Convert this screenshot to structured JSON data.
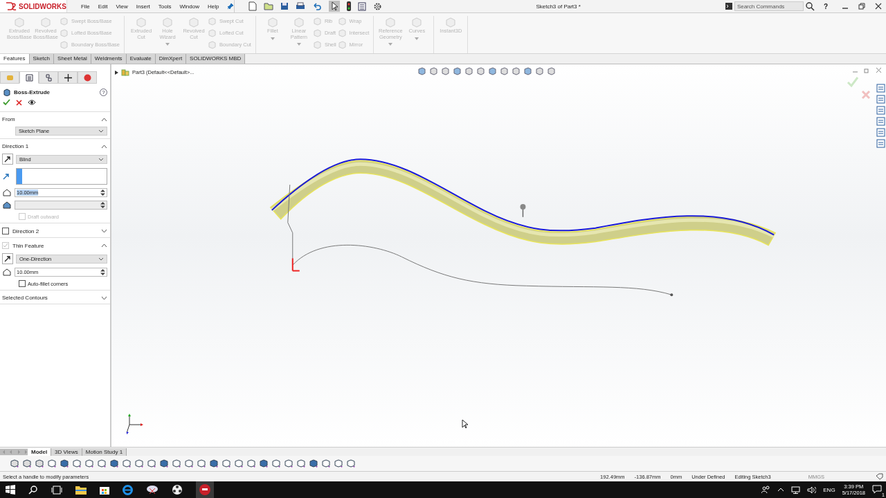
{
  "titlebar": {
    "logo": "SOLIDWORKS",
    "menu": [
      "File",
      "Edit",
      "View",
      "Insert",
      "Tools",
      "Window",
      "Help"
    ],
    "document_title": "Sketch3 of Part3 *",
    "search": {
      "placeholder": "Search Commands"
    },
    "help": "?"
  },
  "ribbon": {
    "groups": [
      {
        "columns": [
          {
            "kind": "large",
            "items": [
              {
                "label": "Extruded\nBoss/Base",
                "disabled": true,
                "dropdown": false
              }
            ]
          },
          {
            "kind": "large",
            "items": [
              {
                "label": "Revolved\nBoss/Base",
                "disabled": true,
                "dropdown": false
              }
            ]
          },
          {
            "kind": "stack",
            "items": [
              {
                "label": "Swept Boss/Base",
                "disabled": true
              },
              {
                "label": "Lofted Boss/Base",
                "disabled": true
              },
              {
                "label": "Boundary Boss/Base",
                "disabled": true
              }
            ]
          }
        ]
      },
      {
        "columns": [
          {
            "kind": "large",
            "items": [
              {
                "label": "Extruded\nCut",
                "disabled": true,
                "dropdown": false
              }
            ]
          },
          {
            "kind": "large",
            "items": [
              {
                "label": "Hole\nWizard",
                "disabled": true,
                "dropdown": true
              }
            ]
          },
          {
            "kind": "large",
            "items": [
              {
                "label": "Revolved\nCut",
                "disabled": true,
                "dropdown": false
              }
            ]
          },
          {
            "kind": "stack",
            "items": [
              {
                "label": "Swept Cut",
                "disabled": true
              },
              {
                "label": "Lofted Cut",
                "disabled": true
              },
              {
                "label": "Boundary Cut",
                "disabled": true
              }
            ]
          }
        ]
      },
      {
        "columns": [
          {
            "kind": "large",
            "items": [
              {
                "label": "Fillet",
                "disabled": true,
                "dropdown": true
              }
            ]
          },
          {
            "kind": "large",
            "items": [
              {
                "label": "Linear\nPattern",
                "disabled": true,
                "dropdown": true
              }
            ]
          },
          {
            "kind": "stack",
            "items": [
              {
                "label": "Rib",
                "disabled": true
              },
              {
                "label": "Draft",
                "disabled": true
              },
              {
                "label": "Shell",
                "disabled": true
              }
            ]
          },
          {
            "kind": "stack",
            "items": [
              {
                "label": "Wrap",
                "disabled": true
              },
              {
                "label": "Intersect",
                "disabled": true
              },
              {
                "label": "Mirror",
                "disabled": true
              }
            ]
          }
        ]
      },
      {
        "columns": [
          {
            "kind": "large",
            "items": [
              {
                "label": "Reference\nGeometry",
                "disabled": true,
                "dropdown": true
              }
            ]
          },
          {
            "kind": "large",
            "items": [
              {
                "label": "Curves",
                "disabled": true,
                "dropdown": true
              }
            ]
          }
        ]
      },
      {
        "columns": [
          {
            "kind": "large",
            "items": [
              {
                "label": "Instant3D",
                "disabled": true,
                "dropdown": false
              }
            ]
          }
        ]
      }
    ]
  },
  "command_tabs": [
    {
      "label": "Features",
      "selected": true
    },
    {
      "label": "Sketch",
      "selected": false
    },
    {
      "label": "Sheet Metal",
      "selected": false
    },
    {
      "label": "Weldments",
      "selected": false
    },
    {
      "label": "Evaluate",
      "selected": false
    },
    {
      "label": "DimXpert",
      "selected": false
    },
    {
      "label": "SOLIDWORKS MBD",
      "selected": false
    }
  ],
  "panel_tabs": [
    {
      "selected": false
    },
    {
      "selected": true
    },
    {
      "selected": false
    },
    {
      "selected": false
    },
    {
      "selected": false
    }
  ],
  "property_manager": {
    "title": "Boss-Extrude",
    "help": "?",
    "sections": [
      {
        "title": "From",
        "kind": "plain",
        "expanded": true,
        "controls": [
          {
            "kind": "select",
            "value": "Sketch Plane"
          }
        ]
      },
      {
        "title": "Direction 1",
        "kind": "plain",
        "expanded": true,
        "controls": [
          {
            "kind": "select",
            "value": "Blind"
          },
          {
            "kind": "selection_box"
          },
          {
            "kind": "spin",
            "value": "10.00mm",
            "selected": true,
            "disabled": false
          },
          {
            "kind": "spin",
            "disabled": true
          },
          {
            "kind": "checkbox",
            "label": "Draft outward",
            "checked": false,
            "disabled": true
          }
        ]
      },
      {
        "title": "Direction 2",
        "kind": "checkbox",
        "checked": false,
        "disabled": false,
        "expanded": false
      },
      {
        "title": "Thin Feature",
        "kind": "checkbox",
        "checked": true,
        "disabled": true,
        "expanded": true,
        "controls": [
          {
            "kind": "select",
            "value": "One-Direction"
          },
          {
            "kind": "spin",
            "value": "10.00mm",
            "selected": false,
            "disabled": false
          },
          {
            "kind": "checkbox",
            "label": "Auto-fillet corners",
            "checked": false,
            "disabled": false
          }
        ]
      },
      {
        "title": "Selected Contours",
        "kind": "plain",
        "expanded": false
      }
    ]
  },
  "tree": {
    "label": "Part3  (Default<<Default>..."
  },
  "bottom_tabs": [
    {
      "label": "Model",
      "selected": true
    },
    {
      "label": "3D Views",
      "selected": false
    },
    {
      "label": "Motion Study 1",
      "selected": false
    }
  ],
  "status_bar": {
    "message": "Select a handle to modify parameters",
    "fields": [
      "192.49mm",
      "-136.87mm",
      "0mm",
      "Under Defined",
      "Editing Sketch3"
    ],
    "units": "MMGS"
  },
  "taskbar": {
    "language": "ENG",
    "time": "3:39 PM",
    "date": "5/17/2018",
    "notifications": "1"
  }
}
